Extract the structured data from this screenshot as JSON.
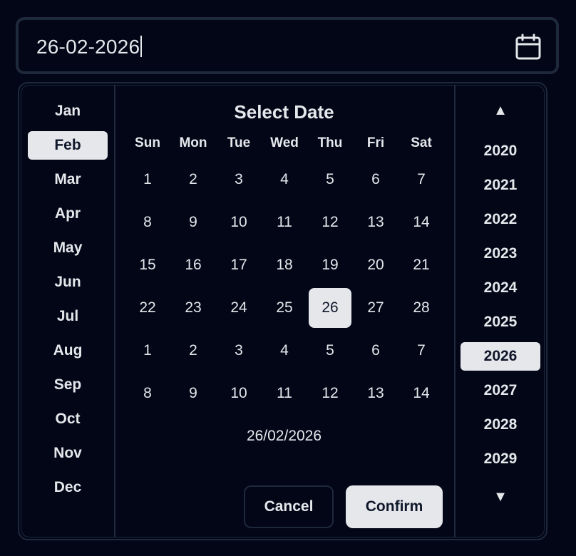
{
  "input": {
    "value": "26-02-2026"
  },
  "icons": {
    "calendar": "calendar-icon",
    "up": "chevron-up-icon",
    "down": "chevron-down-icon"
  },
  "header": {
    "title": "Select Date"
  },
  "weekdays": [
    "Sun",
    "Mon",
    "Tue",
    "Wed",
    "Thu",
    "Fri",
    "Sat"
  ],
  "months": [
    "Jan",
    "Feb",
    "Mar",
    "Apr",
    "May",
    "Jun",
    "Jul",
    "Aug",
    "Sep",
    "Oct",
    "Nov",
    "Dec"
  ],
  "selected_month": "Feb",
  "years": [
    "2020",
    "2021",
    "2022",
    "2023",
    "2024",
    "2025",
    "2026",
    "2027",
    "2028",
    "2029"
  ],
  "selected_year": "2026",
  "year_arrows": {
    "up": "▲",
    "down": "▼"
  },
  "days": [
    [
      "1",
      "2",
      "3",
      "4",
      "5",
      "6",
      "7"
    ],
    [
      "8",
      "9",
      "10",
      "11",
      "12",
      "13",
      "14"
    ],
    [
      "15",
      "16",
      "17",
      "18",
      "19",
      "20",
      "21"
    ],
    [
      "22",
      "23",
      "24",
      "25",
      "26",
      "27",
      "28"
    ],
    [
      "1",
      "2",
      "3",
      "4",
      "5",
      "6",
      "7"
    ],
    [
      "8",
      "9",
      "10",
      "11",
      "12",
      "13",
      "14"
    ]
  ],
  "selected_day": "26",
  "selected_day_position": {
    "row": 3,
    "col": 4
  },
  "selected_readout": "26/02/2026",
  "buttons": {
    "cancel": "Cancel",
    "confirm": "Confirm"
  },
  "colors": {
    "background": "#020617",
    "border": "#1e293b",
    "highlight": "#e5e7eb",
    "text": "#e5e7eb"
  }
}
